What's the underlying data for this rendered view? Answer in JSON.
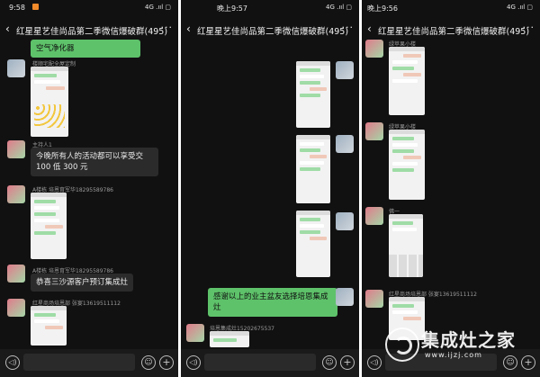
{
  "phones": [
    {
      "status": {
        "time": "9:58",
        "signal": "4G .ııl ▢"
      },
      "title": "红星星艺佳尚品第二季微信爆破群(495)",
      "messages": {
        "m1": "空气净化器",
        "s1": "楼顺宅配全屋定制",
        "s2": "主持人1",
        "m2": "今晚所有人的活动都可以享受交100 低 300 元",
        "s3": "A楼栋 培恩育军华18295589786",
        "s4": "A楼栋 培恩育军华18295589786",
        "m3": "恭喜三沙源客户预订集成灶",
        "s5": "红星商场培恩部 张宴13619511112"
      }
    },
    {
      "status": {
        "time": "晚上9:57",
        "signal": "4G .ııl ▢"
      },
      "title": "红星星艺佳尚品第二季微信爆破群(495)",
      "messages": {
        "m1": "感谢以上的业主盆友选择培恩集成灶",
        "s1": "培恩集成灶15202675537"
      }
    },
    {
      "status": {
        "time": "晚上9:56",
        "signal": "4G .ııl ▢"
      },
      "title": "红星星艺佳尚品第二季微信爆破群(495)",
      "messages": {
        "s1": "绿苹果小楼",
        "s2": "绿苹果小楼",
        "s3": "佛一",
        "s4": "红星商场培恩部 张宴13619511112"
      }
    }
  ],
  "icons": {
    "back": "‹",
    "more": "···",
    "voice": "◁)",
    "smile": "☺",
    "plus": "+"
  },
  "watermark": {
    "name": "集成灶之家",
    "url": "www.ijzj.com"
  }
}
